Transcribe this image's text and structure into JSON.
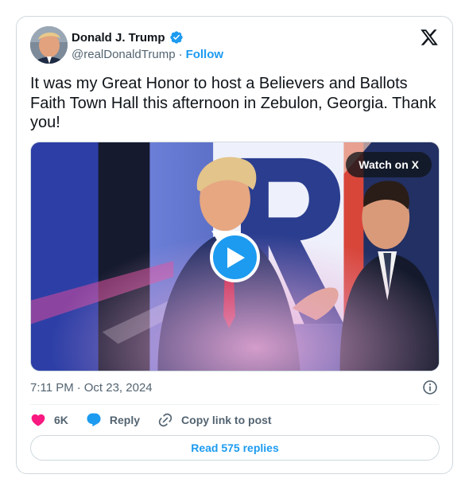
{
  "author": {
    "name": "Donald J. Trump",
    "handle": "@realDonaldTrump",
    "follow_label": "Follow",
    "separator": "·"
  },
  "tweet": {
    "text": "It was my Great Honor to host a Believers and Ballots Faith Town Hall this afternoon in Zebulon, Georgia. Thank you!"
  },
  "media": {
    "watch_label": "Watch on X"
  },
  "meta": {
    "time": "7:11 PM",
    "separator": "·",
    "date": "Oct 23, 2024"
  },
  "actions": {
    "likes_count": "6K",
    "reply_label": "Reply",
    "copy_label": "Copy link to post"
  },
  "replies_button": {
    "label": "Read 575 replies"
  },
  "icons": {
    "verified": "verified-badge-icon",
    "brand": "x-logo-icon",
    "info": "info-icon",
    "like": "heart-icon",
    "reply": "speech-bubble-icon",
    "copy": "link-icon",
    "play": "play-icon"
  },
  "colors": {
    "accent": "#1d9bf0",
    "like": "#f91880",
    "text": "#0f1419",
    "muted": "#536471",
    "border": "#cfd9de"
  }
}
